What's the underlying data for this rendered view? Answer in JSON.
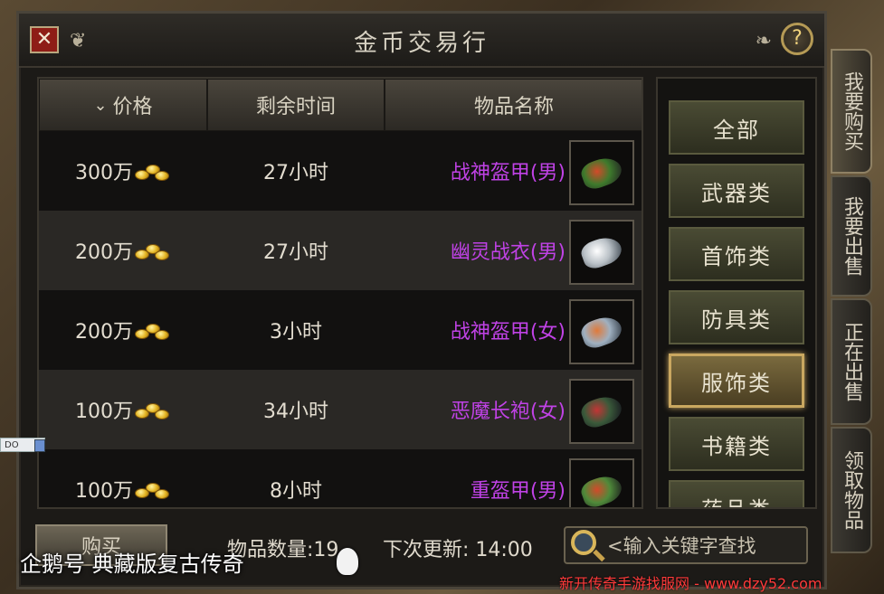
{
  "window": {
    "title": "金币交易行",
    "close_label": "✕",
    "help_label": "?"
  },
  "table": {
    "headers": {
      "price": "价格",
      "time_left": "剩余时间",
      "item_name": "物品名称"
    },
    "rows": [
      {
        "price": "300万",
        "time_left": "27小时",
        "name": "战神盔甲(男)"
      },
      {
        "price": "200万",
        "time_left": "27小时",
        "name": "幽灵战衣(男)"
      },
      {
        "price": "200万",
        "time_left": "3小时",
        "name": "战神盔甲(女)"
      },
      {
        "price": "100万",
        "time_left": "34小时",
        "name": "恶魔长袍(女)"
      },
      {
        "price": "100万",
        "time_left": "8小时",
        "name": "重盔甲(男)"
      }
    ]
  },
  "categories": [
    {
      "label": "全部",
      "active": false
    },
    {
      "label": "武器类",
      "active": false
    },
    {
      "label": "首饰类",
      "active": false
    },
    {
      "label": "防具类",
      "active": false
    },
    {
      "label": "服饰类",
      "active": true
    },
    {
      "label": "书籍类",
      "active": false
    },
    {
      "label": "药品类",
      "active": false
    }
  ],
  "side_tabs": [
    {
      "label": "我要购买",
      "active": true
    },
    {
      "label": "我要出售",
      "active": false
    },
    {
      "label": "正在出售",
      "active": false
    },
    {
      "label": "领取物品",
      "active": false
    }
  ],
  "footer": {
    "buy_label": "购买",
    "item_count": "物品数量:19",
    "next_update": "下次更新: 14:00",
    "search_placeholder": "<输入关键字查找"
  },
  "overlay": {
    "watermark": "企鹅号 典藏版复古传奇",
    "site": "新开传奇手游找服网 - www.dzy52.com",
    "widget_text": "DO"
  }
}
